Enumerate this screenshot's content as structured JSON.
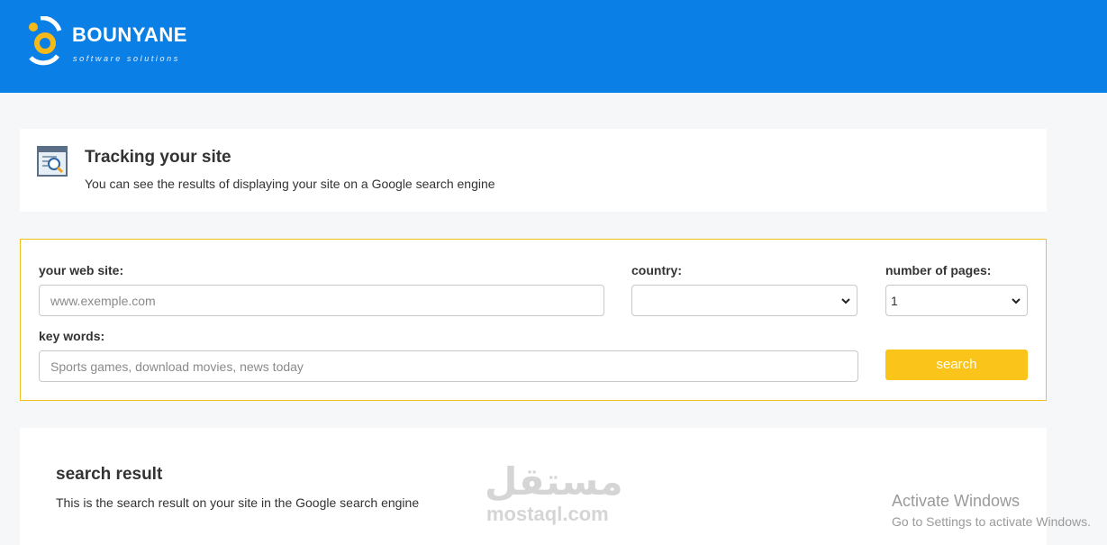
{
  "header": {
    "brand_name": "BOUNYANE",
    "brand_tagline": "software solutions",
    "background_color": "#0a7fe6",
    "logo_accent": "#f6b91a"
  },
  "intro": {
    "icon": "search-document-icon",
    "title": "Tracking your site",
    "subtitle": "You can see the results of displaying your site on a Google search engine"
  },
  "form": {
    "website_label": "your web site:",
    "website_placeholder": "www.exemple.com",
    "website_value": "",
    "country_label": "country:",
    "country_value": "",
    "pages_label": "number of pages:",
    "pages_value": "1",
    "keywords_label": "key words:",
    "keywords_placeholder": "Sports games, download movies, news today",
    "keywords_value": "",
    "search_button": "search",
    "accent_color": "#fbc41a"
  },
  "result": {
    "title": "search result",
    "subtitle": "This is the search result on your site in the Google search engine"
  },
  "watermark": {
    "arabic": "مستقل",
    "latin": "mostaql.com"
  },
  "os_overlay": {
    "title": "Activate Windows",
    "subtitle": "Go to Settings to activate Windows."
  }
}
